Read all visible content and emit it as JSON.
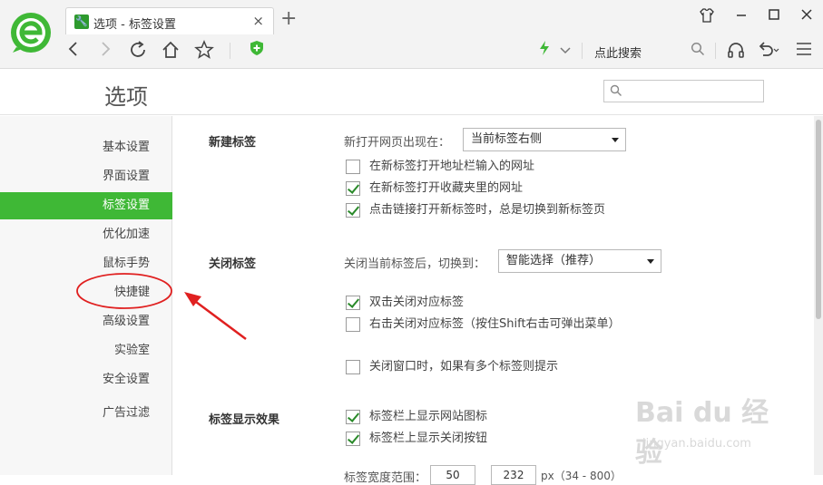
{
  "browser": {
    "tab_title": "选项 - 标签设置",
    "tab_close": "×",
    "new_tab": "+",
    "search_placeholder": "点此搜索",
    "accent_color": "#3fb836",
    "icons": [
      "logo-e-icon",
      "tab-wrench-icon",
      "back-icon",
      "forward-icon",
      "refresh-icon",
      "home-icon",
      "star-icon",
      "shield-plus-icon",
      "lightning-icon",
      "chevron-down-icon",
      "search-icon",
      "headphones-icon",
      "undo-icon",
      "menu-icon",
      "shirt-skin-icon",
      "minimize-icon",
      "maximize-icon",
      "close-icon"
    ]
  },
  "page": {
    "title": "选项",
    "search_value": ""
  },
  "sidebar": {
    "items": [
      {
        "label": "基本设置"
      },
      {
        "label": "界面设置"
      },
      {
        "label": "标签设置",
        "active": true
      },
      {
        "label": "优化加速"
      },
      {
        "label": "鼠标手势"
      },
      {
        "label": "快捷键",
        "circled": true
      },
      {
        "label": "高级设置"
      },
      {
        "label": "实验室"
      },
      {
        "label": "安全设置"
      },
      {
        "label": "广告过滤"
      }
    ]
  },
  "sections": {
    "new_tab": {
      "title": "新建标签",
      "open_label": "新打开网页出现在：",
      "open_value": "当前标签右侧",
      "options": [
        {
          "label": "在新标签打开地址栏输入的网址",
          "checked": false
        },
        {
          "label": "在新标签打开收藏夹里的网址",
          "checked": true
        },
        {
          "label": "点击链接打开新标签时，总是切换到新标签页",
          "checked": true
        }
      ]
    },
    "close_tab": {
      "title": "关闭标签",
      "switch_label": "关闭当前标签后，切换到：",
      "switch_value": "智能选择（推荐）",
      "options": [
        {
          "label": "双击关闭对应标签",
          "checked": true
        },
        {
          "label": "右击关闭对应标签（按住Shift右击可弹出菜单）",
          "checked": false
        },
        {
          "label": "关闭窗口时，如果有多个标签则提示",
          "checked": false
        }
      ]
    },
    "display": {
      "title": "标签显示效果",
      "options": [
        {
          "label": "标签栏上显示网站图标",
          "checked": true
        },
        {
          "label": "标签栏上显示关闭按钮",
          "checked": true
        }
      ],
      "width_label": "标签宽度范围：",
      "width_min": "50",
      "width_max": "232",
      "width_hint": "px（34 - 800）"
    }
  },
  "watermark": {
    "brand": "Bai du 经验",
    "url": "jingyan.baidu.com"
  }
}
